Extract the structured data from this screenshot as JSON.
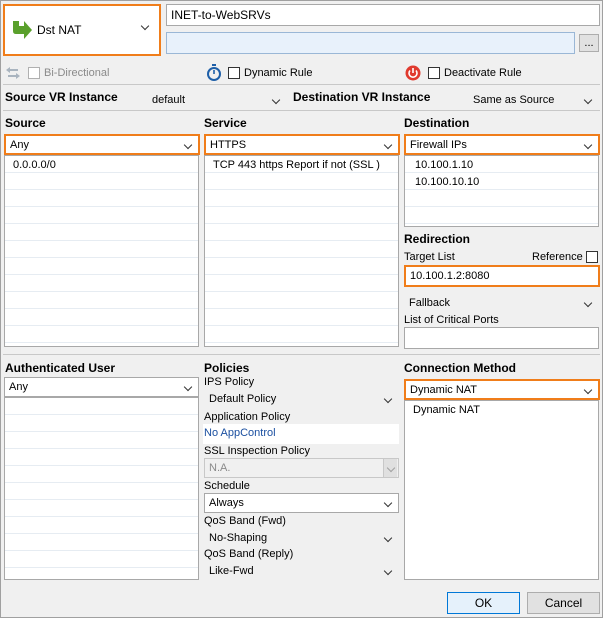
{
  "rule": {
    "action_label": "Dst NAT",
    "name": "INET-to-WebSRVs",
    "description": ""
  },
  "options": {
    "bidirectional_label": "Bi-Directional",
    "dynamic_rule_label": "Dynamic Rule",
    "deactivate_rule_label": "Deactivate Rule"
  },
  "vr": {
    "source_label": "Source VR Instance",
    "source_value": "default",
    "dest_label": "Destination VR Instance",
    "dest_value": "Same as Source"
  },
  "source": {
    "label": "Source",
    "value": "Any",
    "items": [
      "0.0.0.0/0"
    ]
  },
  "service": {
    "label": "Service",
    "value": "HTTPS",
    "items": [
      "TCP  443 https  Report if not (SSL )"
    ]
  },
  "destination": {
    "label": "Destination",
    "value": "Firewall IPs",
    "items": [
      "10.100.1.10",
      "10.100.10.10"
    ]
  },
  "redirection": {
    "label": "Redirection",
    "target_list_label": "Target List",
    "reference_label": "Reference",
    "target_value": "10.100.1.2:8080",
    "fallback_value": "Fallback",
    "critical_ports_label": "List of Critical Ports",
    "critical_ports_value": ""
  },
  "auth_user": {
    "label": "Authenticated User",
    "value": "Any"
  },
  "policies": {
    "label": "Policies",
    "ips_label": "IPS Policy",
    "ips_value": "Default Policy",
    "app_label": "Application Policy",
    "app_value": "No AppControl",
    "ssl_label": "SSL Inspection Policy",
    "ssl_value": "N.A.",
    "schedule_label": "Schedule",
    "schedule_value": "Always",
    "qos_fwd_label": "QoS Band (Fwd)",
    "qos_fwd_value": "No-Shaping",
    "qos_reply_label": "QoS Band (Reply)",
    "qos_reply_value": "Like-Fwd"
  },
  "connection": {
    "label": "Connection Method",
    "value": "Dynamic NAT",
    "items": [
      "Dynamic NAT"
    ]
  },
  "buttons": {
    "ok": "OK",
    "cancel": "Cancel",
    "ellipsis": "..."
  },
  "colors": {
    "highlight": "#f07d1a",
    "action_arrow": "#5aa02c",
    "deactivate_icon": "#e03a2e",
    "timer_icon": "#1e5fa8",
    "link": "#1a4fa0",
    "description_field": "#e8f1fb"
  },
  "icons": {
    "action": "green-arrow-icon",
    "bidirectional": "bidirectional-arrows-icon",
    "dynamic": "stopwatch-icon",
    "deactivate": "power-icon"
  }
}
